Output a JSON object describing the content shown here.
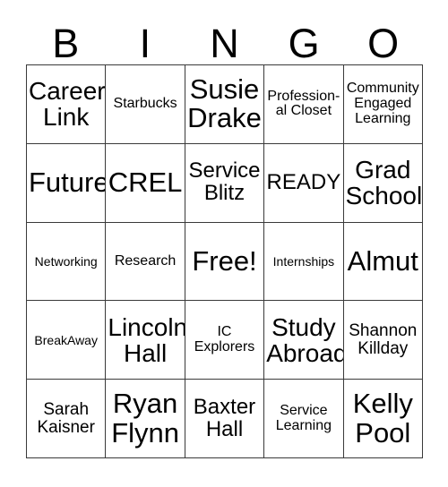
{
  "card": {
    "header_letters": [
      "B",
      "I",
      "N",
      "G",
      "O"
    ],
    "free_space_label": "Free!",
    "rows": [
      [
        {
          "text": "Career Link",
          "size": "xl"
        },
        {
          "text": "Starbucks",
          "size": "s"
        },
        {
          "text": "Susie Drake",
          "size": "xxl"
        },
        {
          "text": "Profession­al Closet",
          "size": "s"
        },
        {
          "text": "Community Engaged Learning",
          "size": "s"
        }
      ],
      [
        {
          "text": "Future",
          "size": "xxl"
        },
        {
          "text": "CREL",
          "size": "xxl"
        },
        {
          "text": "Service Blitz",
          "size": "l"
        },
        {
          "text": "READY",
          "size": "l"
        },
        {
          "text": "Grad School",
          "size": "xl"
        }
      ],
      [
        {
          "text": "Networking",
          "size": "xs"
        },
        {
          "text": "Research",
          "size": "s"
        },
        {
          "text": "Free!",
          "size": "free"
        },
        {
          "text": "Internships",
          "size": "xs"
        },
        {
          "text": "Almut",
          "size": "xxl"
        }
      ],
      [
        {
          "text": "BreakAway",
          "size": "xs"
        },
        {
          "text": "Lincoln Hall",
          "size": "xl"
        },
        {
          "text": "IC Explorers",
          "size": "s"
        },
        {
          "text": "Study Abroad",
          "size": "xl"
        },
        {
          "text": "Shannon Killday",
          "size": "m"
        }
      ],
      [
        {
          "text": "Sarah Kaisner",
          "size": "m"
        },
        {
          "text": "Ryan Flynn",
          "size": "xxl"
        },
        {
          "text": "Baxter Hall",
          "size": "l"
        },
        {
          "text": "Service Learning",
          "size": "s"
        },
        {
          "text": "Kelly Pool",
          "size": "xxl"
        }
      ]
    ],
    "colors": {
      "background": "#ffffff",
      "border": "#3a3a3a",
      "text": "#000000"
    }
  }
}
